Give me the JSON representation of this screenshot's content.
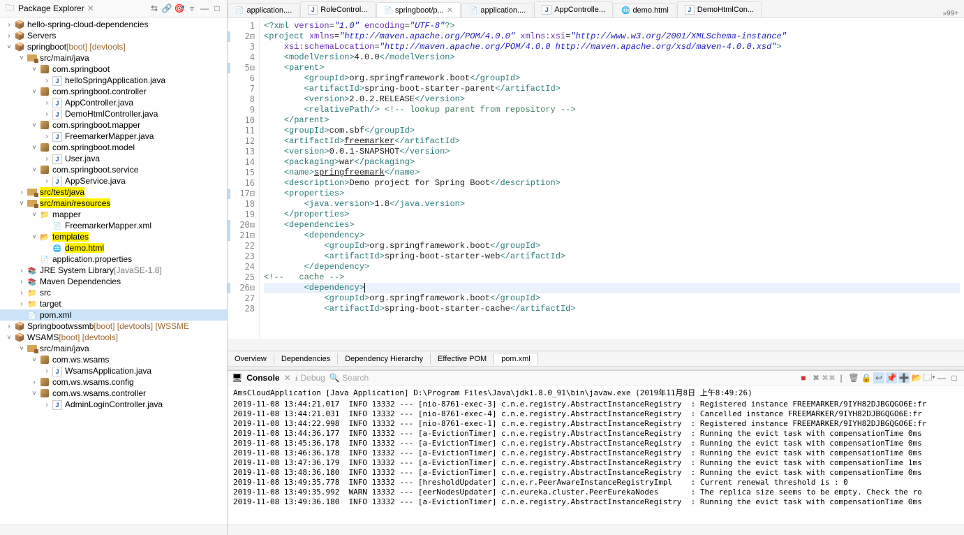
{
  "packageExplorer": {
    "title": "Package Explorer",
    "nodes": [
      {
        "depth": 0,
        "arrow": ">",
        "icon": "project",
        "label": "hello-spring-cloud-dependencies"
      },
      {
        "depth": 0,
        "arrow": ">",
        "icon": "project",
        "label": "Servers"
      },
      {
        "depth": 0,
        "arrow": "v",
        "icon": "project",
        "label": "springboot",
        "suffix": " [boot] [devtools]",
        "suffixClass": "brown"
      },
      {
        "depth": 1,
        "arrow": "v",
        "icon": "srcfolder",
        "label": "src/main/java"
      },
      {
        "depth": 2,
        "arrow": "v",
        "icon": "pkg",
        "label": "com.springboot"
      },
      {
        "depth": 3,
        "arrow": ">",
        "icon": "java",
        "label": "helloSpringApplication.java"
      },
      {
        "depth": 2,
        "arrow": "v",
        "icon": "pkg",
        "label": "com.springboot.controller"
      },
      {
        "depth": 3,
        "arrow": ">",
        "icon": "java",
        "label": "AppController.java"
      },
      {
        "depth": 3,
        "arrow": ">",
        "icon": "java",
        "label": "DemoHtmlController.java"
      },
      {
        "depth": 2,
        "arrow": "v",
        "icon": "pkg",
        "label": "com.springboot.mapper"
      },
      {
        "depth": 3,
        "arrow": ">",
        "icon": "java",
        "label": "FreemarkerMapper.java"
      },
      {
        "depth": 2,
        "arrow": "v",
        "icon": "pkg",
        "label": "com.springboot.model"
      },
      {
        "depth": 3,
        "arrow": ">",
        "icon": "java",
        "label": "User.java"
      },
      {
        "depth": 2,
        "arrow": "v",
        "icon": "pkg",
        "label": "com.springboot.service"
      },
      {
        "depth": 3,
        "arrow": ">",
        "icon": "java",
        "label": "AppService.java"
      },
      {
        "depth": 1,
        "arrow": ">",
        "icon": "srcfolder",
        "label": "src/test/java",
        "hl": true
      },
      {
        "depth": 1,
        "arrow": "v",
        "icon": "srcfolder",
        "label": "src/main/resources",
        "hl": true
      },
      {
        "depth": 2,
        "arrow": "v",
        "icon": "folder",
        "label": "mapper"
      },
      {
        "depth": 3,
        "arrow": "",
        "icon": "xml",
        "label": "FreemarkerMapper.xml"
      },
      {
        "depth": 2,
        "arrow": "v",
        "icon": "folder-open",
        "label": "templates",
        "hl": true
      },
      {
        "depth": 3,
        "arrow": "",
        "icon": "html",
        "label": "demo.html",
        "hl": true
      },
      {
        "depth": 2,
        "arrow": "",
        "icon": "file",
        "label": "application.properties"
      },
      {
        "depth": 1,
        "arrow": ">",
        "icon": "lib",
        "label": "JRE System Library",
        "suffix": " [JavaSE-1.8]",
        "suffixClass": "gray"
      },
      {
        "depth": 1,
        "arrow": ">",
        "icon": "lib",
        "label": "Maven Dependencies"
      },
      {
        "depth": 1,
        "arrow": ">",
        "icon": "folder",
        "label": "src"
      },
      {
        "depth": 1,
        "arrow": ">",
        "icon": "folder",
        "label": "target"
      },
      {
        "depth": 1,
        "arrow": "",
        "icon": "xml",
        "label": "pom.xml",
        "selected": true
      },
      {
        "depth": 0,
        "arrow": ">",
        "icon": "project",
        "label": "Springbootwssmb",
        "suffix": " [boot] [devtools] [WSSME",
        "suffixClass": "brown"
      },
      {
        "depth": 0,
        "arrow": "v",
        "icon": "project",
        "label": "WSAMS",
        "suffix": " [boot] [devtools]",
        "suffixClass": "brown"
      },
      {
        "depth": 1,
        "arrow": "v",
        "icon": "srcfolder",
        "label": "src/main/java"
      },
      {
        "depth": 2,
        "arrow": "v",
        "icon": "pkg",
        "label": "com.ws.wsams"
      },
      {
        "depth": 3,
        "arrow": ">",
        "icon": "java",
        "label": "WsamsApplication.java"
      },
      {
        "depth": 2,
        "arrow": ">",
        "icon": "pkg",
        "label": "com.ws.wsams.config"
      },
      {
        "depth": 2,
        "arrow": "v",
        "icon": "pkg",
        "label": "com.ws.wsams.controller"
      },
      {
        "depth": 3,
        "arrow": ">",
        "icon": "java",
        "label": "AdminLoginController.java"
      }
    ]
  },
  "editorTabs": [
    {
      "icon": "file",
      "label": "application...."
    },
    {
      "icon": "java",
      "label": "RoleControl..."
    },
    {
      "icon": "xml",
      "label": "springboot/p...",
      "active": true
    },
    {
      "icon": "file",
      "label": "application...."
    },
    {
      "icon": "java",
      "label": "AppControlle..."
    },
    {
      "icon": "html",
      "label": "demo.html"
    },
    {
      "icon": "java",
      "label": "DemoHtmlCon..."
    }
  ],
  "tabsOverflow": "»99+",
  "codeLines": [
    {
      "n": 1,
      "html": "<span class='t-pi'>&lt;?xml</span> <span class='t-attr'>version</span>=<span class='t-str'>\"1.0\"</span> <span class='t-attr'>encoding</span>=<span class='t-str'>\"UTF-8\"</span><span class='t-pi'>?&gt;</span>"
    },
    {
      "n": 2,
      "fold": true,
      "html": "<span class='t-tag'>&lt;project</span> <span class='t-attr'>xmlns</span>=<span class='t-str'>\"http://maven.apache.org/POM/4.0.0\"</span> <span class='t-attr'>xmlns:xsi</span>=<span class='t-str'>\"http://www.w3.org/2001/XMLSchema-instance\"</span>"
    },
    {
      "n": 3,
      "html": "    <span class='t-attr'>xsi:schemaLocation</span>=<span class='t-str'>\"http://maven.apache.org/POM/4.0.0 http://maven.apache.org/xsd/maven-4.0.0.xsd\"</span><span class='t-tag'>&gt;</span>"
    },
    {
      "n": 4,
      "html": "    <span class='t-tag'>&lt;modelVersion&gt;</span>4.0.0<span class='t-tag'>&lt;/modelVersion&gt;</span>"
    },
    {
      "n": 5,
      "fold": true,
      "html": "    <span class='t-tag'>&lt;parent&gt;</span>"
    },
    {
      "n": 6,
      "html": "        <span class='t-tag'>&lt;groupId&gt;</span>org.springframework.boot<span class='t-tag'>&lt;/groupId&gt;</span>"
    },
    {
      "n": 7,
      "html": "        <span class='t-tag'>&lt;artifactId&gt;</span>spring-boot-starter-parent<span class='t-tag'>&lt;/artifactId&gt;</span>"
    },
    {
      "n": 8,
      "html": "        <span class='t-tag'>&lt;version&gt;</span>2.0.2.RELEASE<span class='t-tag'>&lt;/version&gt;</span>"
    },
    {
      "n": 9,
      "html": "        <span class='t-tag'>&lt;relativePath/&gt;</span> <span class='t-comment'>&lt;!-- lookup parent from repository --&gt;</span>"
    },
    {
      "n": 10,
      "html": "    <span class='t-tag'>&lt;/parent&gt;</span>"
    },
    {
      "n": 11,
      "html": "    <span class='t-tag'>&lt;groupId&gt;</span>com.sbf<span class='t-tag'>&lt;/groupId&gt;</span>"
    },
    {
      "n": 12,
      "html": "    <span class='t-tag'>&lt;artifactId&gt;</span><u>freemarker</u><span class='t-tag'>&lt;/artifactId&gt;</span>"
    },
    {
      "n": 13,
      "html": "    <span class='t-tag'>&lt;version&gt;</span>0.0.1-SNAPSHOT<span class='t-tag'>&lt;/version&gt;</span>"
    },
    {
      "n": 14,
      "html": "    <span class='t-tag'>&lt;packaging&gt;</span>war<span class='t-tag'>&lt;/packaging&gt;</span>"
    },
    {
      "n": 15,
      "html": "    <span class='t-tag'>&lt;name&gt;</span><u>springfreemark</u><span class='t-tag'>&lt;/name&gt;</span>"
    },
    {
      "n": 16,
      "html": "    <span class='t-tag'>&lt;description&gt;</span>Demo project for Spring Boot<span class='t-tag'>&lt;/description&gt;</span>"
    },
    {
      "n": 17,
      "fold": true,
      "html": "    <span class='t-tag'>&lt;properties&gt;</span>"
    },
    {
      "n": 18,
      "html": "        <span class='t-tag'>&lt;java.version&gt;</span>1.8<span class='t-tag'>&lt;/java.version&gt;</span>"
    },
    {
      "n": 19,
      "html": "    <span class='t-tag'>&lt;/properties&gt;</span>"
    },
    {
      "n": 20,
      "fold": true,
      "html": "    <span class='t-tag'>&lt;dependencies&gt;</span>"
    },
    {
      "n": 21,
      "fold": true,
      "html": "        <span class='t-tag'>&lt;dependency&gt;</span>"
    },
    {
      "n": 22,
      "html": "            <span class='t-tag'>&lt;groupId&gt;</span>org.springframework.boot<span class='t-tag'>&lt;/groupId&gt;</span>"
    },
    {
      "n": 23,
      "html": "            <span class='t-tag'>&lt;artifactId&gt;</span>spring-boot-starter-web<span class='t-tag'>&lt;/artifactId&gt;</span>"
    },
    {
      "n": 24,
      "html": "        <span class='t-tag'>&lt;/dependency&gt;</span>"
    },
    {
      "n": 25,
      "html": "<span class='t-comment'>&lt;!--   cache --&gt;</span>"
    },
    {
      "n": 26,
      "fold": true,
      "caret": true,
      "html": "        <span class='t-tag'>&lt;dependency&gt;</span><span style='border-left:1px solid #000;'>&nbsp;</span>"
    },
    {
      "n": 27,
      "html": "            <span class='t-tag'>&lt;groupId&gt;</span>org.springframework.boot<span class='t-tag'>&lt;/groupId&gt;</span>"
    },
    {
      "n": 28,
      "html": "            <span class='t-tag'>&lt;artifactId&gt;</span>spring-boot-starter-cache<span class='t-tag'>&lt;/artifactId&gt;</span>"
    }
  ],
  "bottomTabs": [
    "Overview",
    "Dependencies",
    "Dependency Hierarchy",
    "Effective POM",
    "pom.xml"
  ],
  "bottomActive": "pom.xml",
  "console": {
    "title": "Console",
    "views": [
      "Debug",
      "Search"
    ],
    "headerApp": "AmsCloudApplication [Java Application] D:\\Program Files\\Java\\jdk1.8.0_91\\bin\\javaw.exe (2019年11月8日 上午8:49:26)",
    "lines": [
      "2019-11-08 13:44:21.017  INFO 13332 --- [nio-8761-exec-3] c.n.e.registry.AbstractInstanceRegistry  : Registered instance FREEMARKER/9IYH82DJBGQGO6E:fr",
      "2019-11-08 13:44:21.031  INFO 13332 --- [nio-8761-exec-4] c.n.e.registry.AbstractInstanceRegistry  : Cancelled instance FREEMARKER/9IYH82DJBGQGO6E:fr",
      "2019-11-08 13:44:22.998  INFO 13332 --- [nio-8761-exec-1] c.n.e.registry.AbstractInstanceRegistry  : Registered instance FREEMARKER/9IYH82DJBGQGO6E:fr",
      "2019-11-08 13:44:36.177  INFO 13332 --- [a-EvictionTimer] c.n.e.registry.AbstractInstanceRegistry  : Running the evict task with compensationTime 0ms",
      "2019-11-08 13:45:36.178  INFO 13332 --- [a-EvictionTimer] c.n.e.registry.AbstractInstanceRegistry  : Running the evict task with compensationTime 0ms",
      "2019-11-08 13:46:36.178  INFO 13332 --- [a-EvictionTimer] c.n.e.registry.AbstractInstanceRegistry  : Running the evict task with compensationTime 0ms",
      "2019-11-08 13:47:36.179  INFO 13332 --- [a-EvictionTimer] c.n.e.registry.AbstractInstanceRegistry  : Running the evict task with compensationTime 1ms",
      "2019-11-08 13:48:36.180  INFO 13332 --- [a-EvictionTimer] c.n.e.registry.AbstractInstanceRegistry  : Running the evict task with compensationTime 0ms",
      "2019-11-08 13:49:35.778  INFO 13332 --- [hresholdUpdater] c.n.e.r.PeerAwareInstanceRegistryImpl    : Current renewal threshold is : 0",
      "2019-11-08 13:49:35.992  WARN 13332 --- [eerNodesUpdater] c.n.eureka.cluster.PeerEurekaNodes       : The replica size seems to be empty. Check the ro",
      "2019-11-08 13:49:36.180  INFO 13332 --- [a-EvictionTimer] c.n.e.registry.AbstractInstanceRegistry  : Running the evict task with compensationTime 0ms"
    ]
  }
}
